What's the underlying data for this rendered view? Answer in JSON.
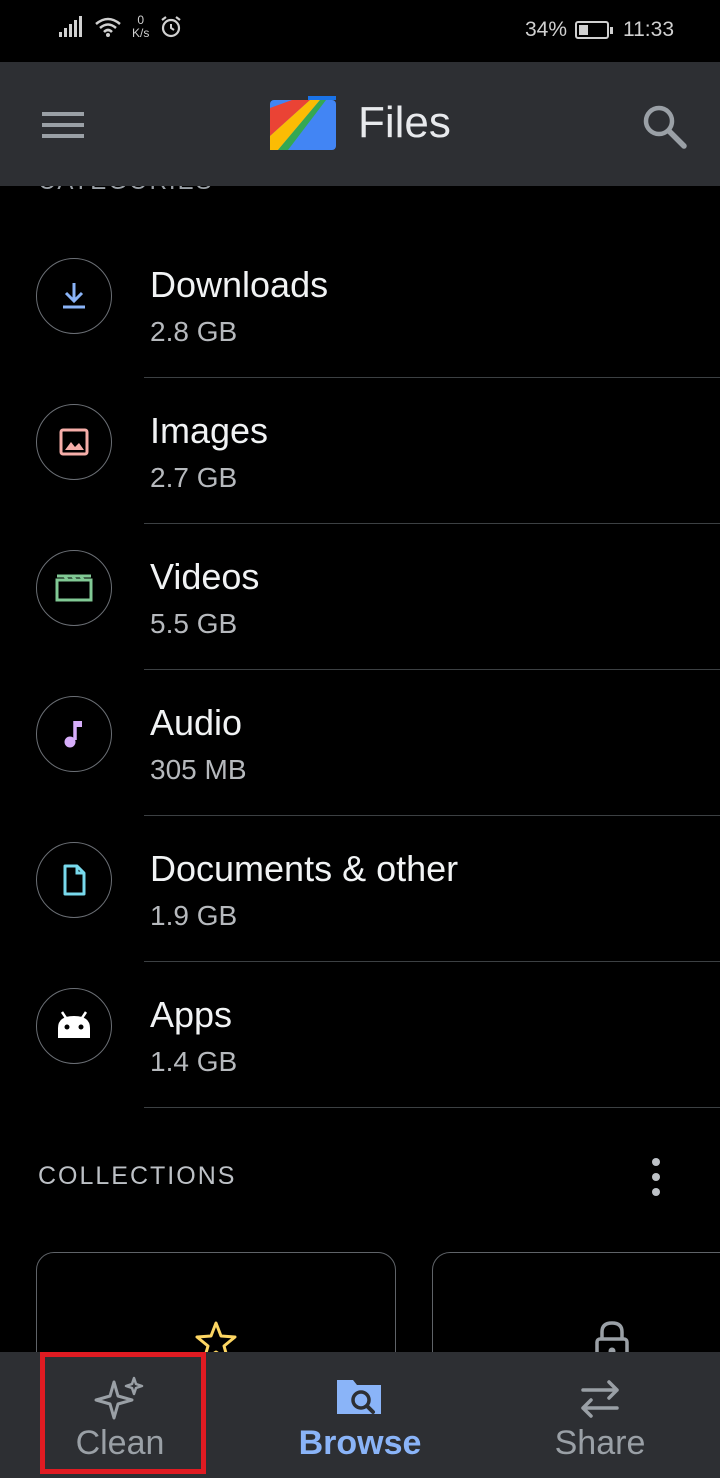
{
  "status_bar": {
    "net_speed_value": "0",
    "net_speed_unit": "K/s",
    "battery": "34%",
    "time": "11:33"
  },
  "app_bar": {
    "title": "Files",
    "menu_icon": "hamburger-menu-icon",
    "search_icon": "search-icon"
  },
  "categories": {
    "header": "CATEGORIES",
    "items": [
      {
        "name": "Downloads",
        "size": "2.8 GB",
        "icon": "download-icon",
        "color": "#8ab4f8"
      },
      {
        "name": "Images",
        "size": "2.7 GB",
        "icon": "image-icon",
        "color": "#f6aea9"
      },
      {
        "name": "Videos",
        "size": "5.5 GB",
        "icon": "video-icon",
        "color": "#81c995"
      },
      {
        "name": "Audio",
        "size": "305 MB",
        "icon": "music-note-icon",
        "color": "#d7aefb"
      },
      {
        "name": "Documents & other",
        "size": "1.9 GB",
        "icon": "document-icon",
        "color": "#78d9ec"
      },
      {
        "name": "Apps",
        "size": "1.4 GB",
        "icon": "android-icon",
        "color": "#ffffff"
      }
    ]
  },
  "collections": {
    "header": "COLLECTIONS",
    "more_icon": "more-vertical-icon",
    "cards": [
      {
        "icon": "star-icon",
        "color": "#fdd663"
      },
      {
        "icon": "lock-icon",
        "color": "#9aa0a6"
      }
    ]
  },
  "bottom_nav": {
    "items": [
      {
        "label": "Clean",
        "icon": "sparkle-icon",
        "active": false
      },
      {
        "label": "Browse",
        "icon": "browse-folder-icon",
        "active": true
      },
      {
        "label": "Share",
        "icon": "swap-arrows-icon",
        "active": false
      }
    ]
  },
  "colors": {
    "accent": "#8ab4f8",
    "surface": "#2d2f33",
    "background": "#000000",
    "highlight": "#e01b22"
  }
}
